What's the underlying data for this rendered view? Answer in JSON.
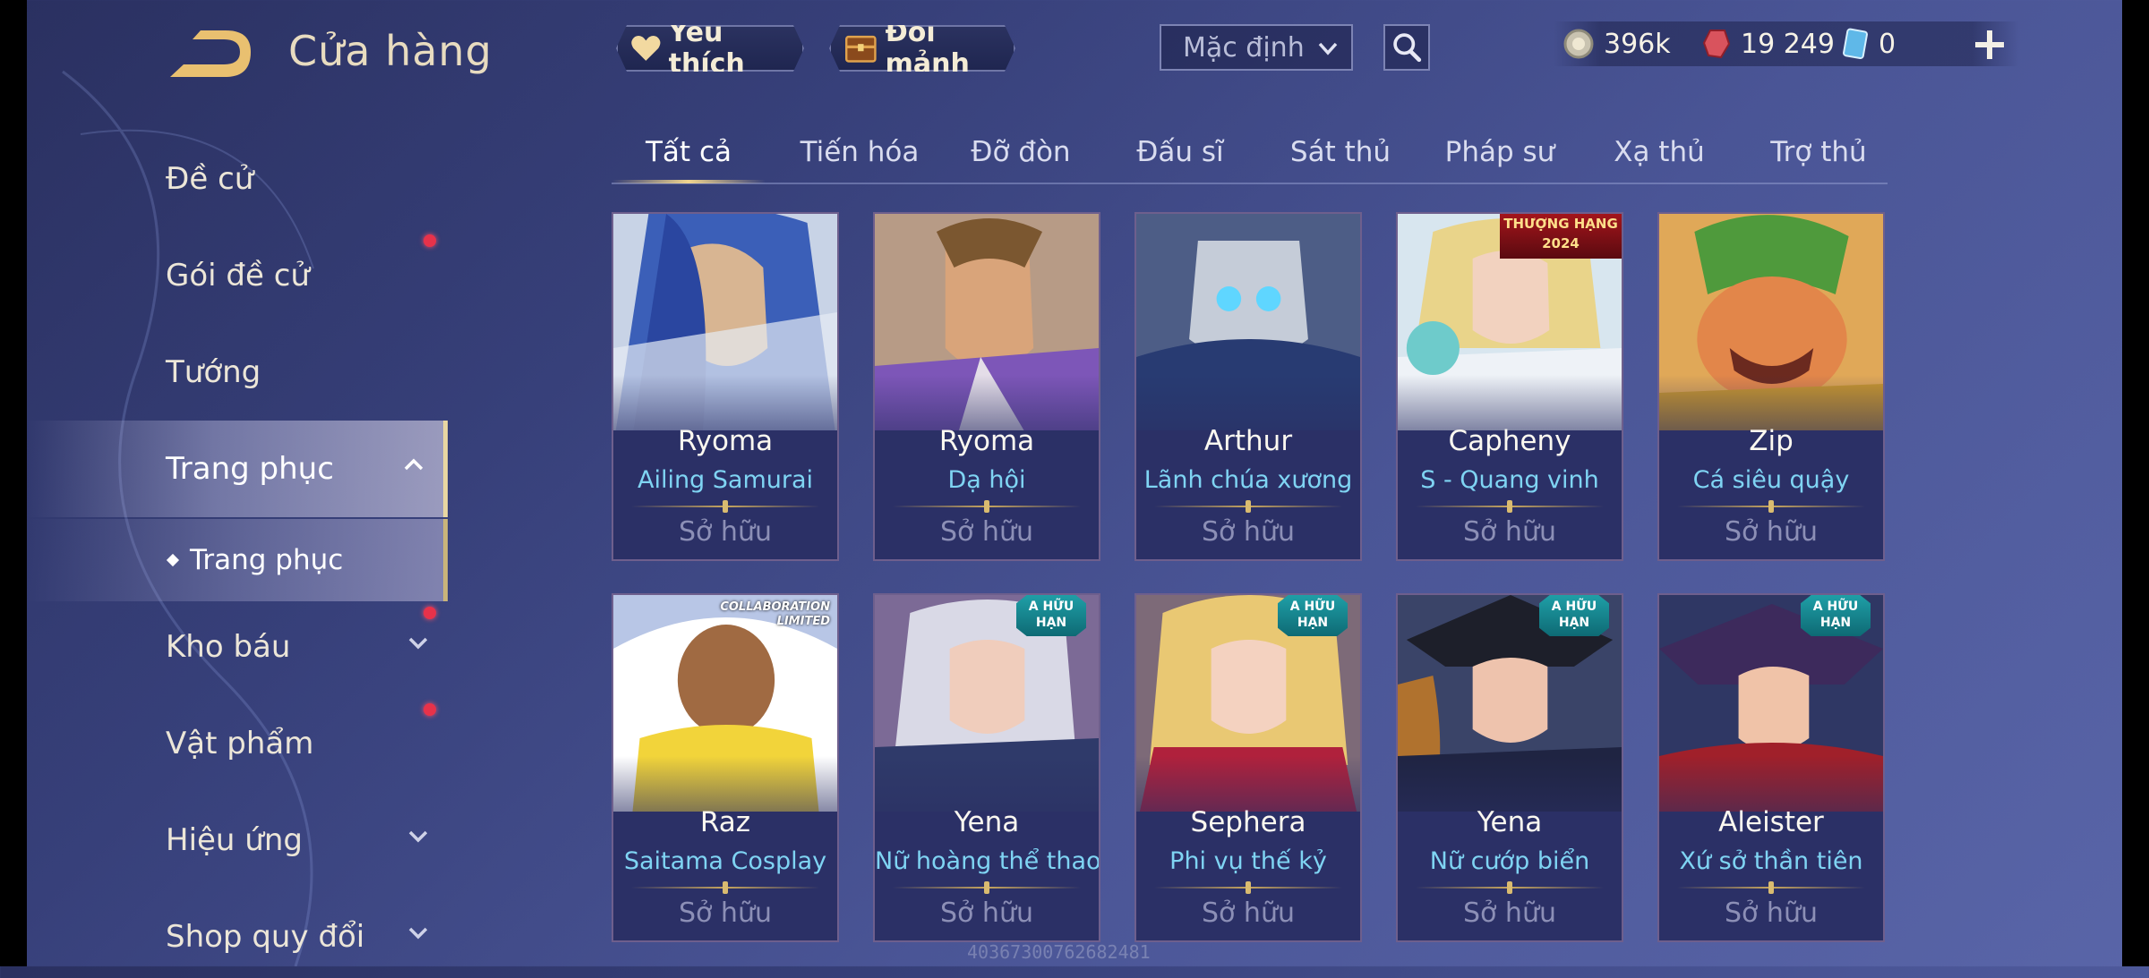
{
  "header": {
    "title": "Cửa hàng"
  },
  "sidebar": {
    "items": [
      {
        "label": "Đề cử"
      },
      {
        "label": "Gói đề cử"
      },
      {
        "label": "Tướng"
      },
      {
        "label": "Trang phục"
      },
      {
        "label": "Kho báu"
      },
      {
        "label": "Vật phẩm"
      },
      {
        "label": "Hiệu ứng"
      },
      {
        "label": "Shop quy đổi"
      }
    ],
    "sub_item": {
      "label": "Trang phục"
    }
  },
  "toolbar": {
    "favorite_label": "Yêu thích",
    "exchange_label": "Đổi mảnh",
    "sort_value": "Mặc định"
  },
  "currency": {
    "gold": "396k",
    "coupons": "19 249",
    "vouchers": "0"
  },
  "tabs": [
    {
      "label": "Tất cả"
    },
    {
      "label": "Tiến hóa"
    },
    {
      "label": "Đỡ đòn"
    },
    {
      "label": "Đấu sĩ"
    },
    {
      "label": "Sát thủ"
    },
    {
      "label": "Pháp sư"
    },
    {
      "label": "Xạ thủ"
    },
    {
      "label": "Trợ thủ"
    }
  ],
  "cards": [
    {
      "hero": "Ryoma",
      "skin": "Ailing Samurai",
      "status": "Sở hữu"
    },
    {
      "hero": "Ryoma",
      "skin": "Dạ hội",
      "status": "Sở hữu"
    },
    {
      "hero": "Arthur",
      "skin": "Lãnh chúa xương",
      "status": "Sở hữu"
    },
    {
      "hero": "Capheny",
      "skin": "S - Quang vinh",
      "status": "Sở hữu",
      "badge": "THƯỢNG HẠNG 2024"
    },
    {
      "hero": "Zip",
      "skin": "Cá siêu quậy",
      "status": "Sở hữu"
    },
    {
      "hero": "Raz",
      "skin": "Saitama Cosplay",
      "status": "Sở hữu",
      "badge": "COLLABORATION LIMITED"
    },
    {
      "hero": "Yena",
      "skin": "Nữ hoàng thể thao",
      "status": "Sở hữu",
      "badge": "A HỮU HẠN"
    },
    {
      "hero": "Sephera",
      "skin": "Phi vụ thế kỷ",
      "status": "Sở hữu",
      "badge": "A HỮU HẠN"
    },
    {
      "hero": "Yena",
      "skin": "Nữ cướp biển",
      "status": "Sở hữu",
      "badge": "A HỮU HẠN"
    },
    {
      "hero": "Aleister",
      "skin": "Xứ sở thần tiên",
      "status": "Sở hữu",
      "badge": "A HỮU HẠN"
    }
  ],
  "watermark": "40367300762682481",
  "colors": {
    "accent_gold": "#e8d6a2",
    "skin_name": "#7fd4f3",
    "notification": "#e8324a"
  }
}
